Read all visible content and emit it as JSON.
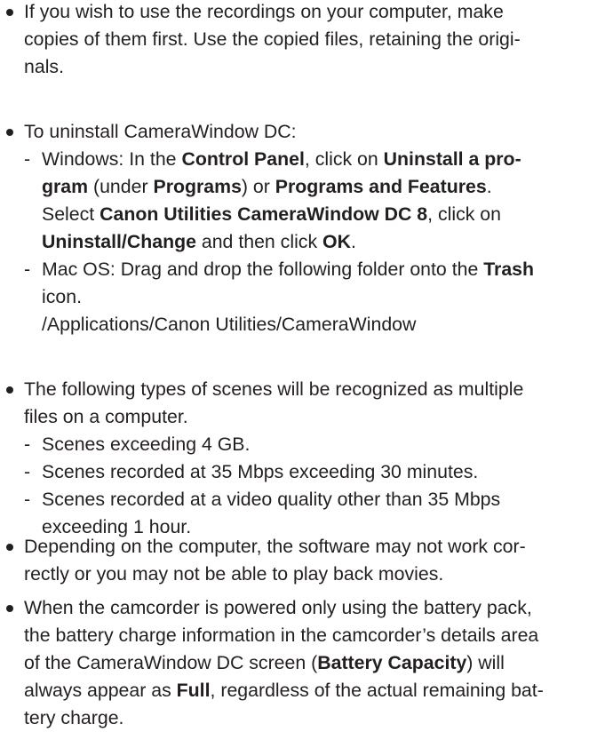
{
  "bullets": [
    {
      "lines": [
        [
          "If you wish to use the recordings on your computer, make"
        ],
        [
          "copies of them first. Use the copied files, retaining the origi-"
        ],
        [
          "nals."
        ]
      ]
    },
    {
      "lines": [
        [
          "To uninstall CameraWindow DC:"
        ]
      ],
      "subs": [
        {
          "lines": [
            [
              "Windows: In the ",
              {
                "b": "Control Panel"
              },
              ", click on ",
              {
                "b": "Uninstall a pro-"
              }
            ],
            [
              {
                "b": "gram"
              },
              " (under ",
              {
                "b": "Programs"
              },
              ") or ",
              {
                "b": "Programs and Features"
              },
              "."
            ],
            [
              "Select ",
              {
                "b": "Canon Utilities CameraWindow DC 8"
              },
              ", click on"
            ],
            [
              {
                "b": "Uninstall/Change"
              },
              " and then click ",
              {
                "b": "OK"
              },
              "."
            ]
          ]
        },
        {
          "lines": [
            [
              "Mac OS: Drag and drop the following folder onto the ",
              {
                "b": "Trash"
              }
            ],
            [
              "icon."
            ],
            [
              "/Applications/Canon Utilities/CameraWindow"
            ]
          ]
        }
      ]
    },
    {
      "lines": [
        [
          "The following types of scenes will be recognized as multiple"
        ],
        [
          "files on a computer."
        ]
      ],
      "subs": [
        {
          "lines": [
            [
              "Scenes exceeding 4 GB."
            ]
          ]
        },
        {
          "lines": [
            [
              "Scenes recorded at 35 Mbps exceeding 30 minutes."
            ]
          ]
        },
        {
          "lines": [
            [
              "Scenes recorded at a video quality other than 35 Mbps"
            ],
            [
              "exceeding 1 hour."
            ]
          ]
        }
      ]
    },
    {
      "lines": [
        [
          "Depending on the computer, the software may not work cor-"
        ],
        [
          "rectly or you may not be able to play back movies."
        ]
      ]
    },
    {
      "lines": [
        [
          "When the camcorder is powered only using the battery pack,"
        ],
        [
          "the battery charge information in the camcorder’s details area"
        ],
        [
          "of the CameraWindow DC screen (",
          {
            "b": "Battery Capacity"
          },
          ") will"
        ],
        [
          "always appear as ",
          {
            "b": "Full"
          },
          ", regardless of the actual remaining bat-"
        ],
        [
          "tery charge."
        ]
      ]
    }
  ]
}
